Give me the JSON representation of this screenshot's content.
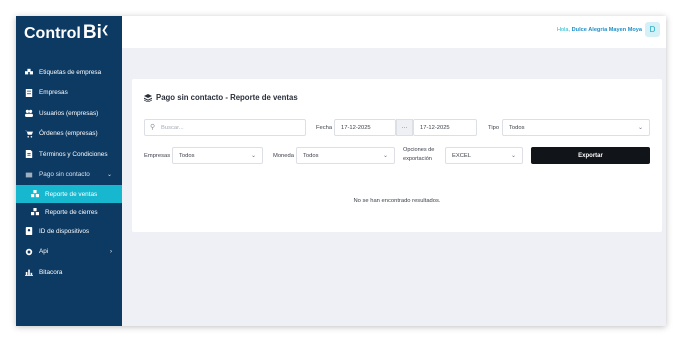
{
  "app": {
    "logo_text": "Control",
    "logo_mark": "Bi",
    "collapse_icon": "chevron-left-icon"
  },
  "sidebar": {
    "items": [
      {
        "label": "Etiquetas de empresa",
        "icon": "tags-icon"
      },
      {
        "label": "Empresas",
        "icon": "building-icon"
      },
      {
        "label": "Usuarios (empresas)",
        "icon": "users-icon"
      },
      {
        "label": "Órdenes (empresas)",
        "icon": "cart-icon"
      },
      {
        "label": "Términos y Condiciones",
        "icon": "document-icon"
      },
      {
        "label": "Pago sin contacto",
        "icon": "contactless-icon",
        "expanded": true
      },
      {
        "label": "Reporte de ventas",
        "icon": "boxes-icon",
        "active": true
      },
      {
        "label": "Reporte de cierres",
        "icon": "boxes-icon"
      },
      {
        "label": "ID de dispositivos",
        "icon": "id-card-icon"
      },
      {
        "label": "Api",
        "icon": "code-icon"
      },
      {
        "label": "Bitacora",
        "icon": "chart-icon"
      }
    ]
  },
  "header": {
    "greeting": "Hola,",
    "user_name": "Dulce Alegria Mayen Moya",
    "avatar_initial": "D"
  },
  "main": {
    "title": "Pago sin contacto - Reporte de ventas",
    "search": {
      "placeholder": "Buscar..."
    },
    "fecha": {
      "label": "Fecha",
      "start": "17-12-2025",
      "separator": "···",
      "end": "17-12-2025"
    },
    "tipo": {
      "label": "Tipo",
      "value": "Todos"
    },
    "empresas": {
      "label": "Empresas",
      "value": "Todos"
    },
    "moneda": {
      "label": "Moneda",
      "value": "Todos"
    },
    "export_options": {
      "label_line1": "Opciones de",
      "label_line2": "exportación",
      "value": "EXCEL"
    },
    "export_button": "Exportar",
    "empty_message": "No se han encontrado resultados."
  },
  "colors": {
    "sidebar": "#0d3a63",
    "accent": "#17b8cf",
    "button": "#111418",
    "background": "#eef0f6"
  }
}
